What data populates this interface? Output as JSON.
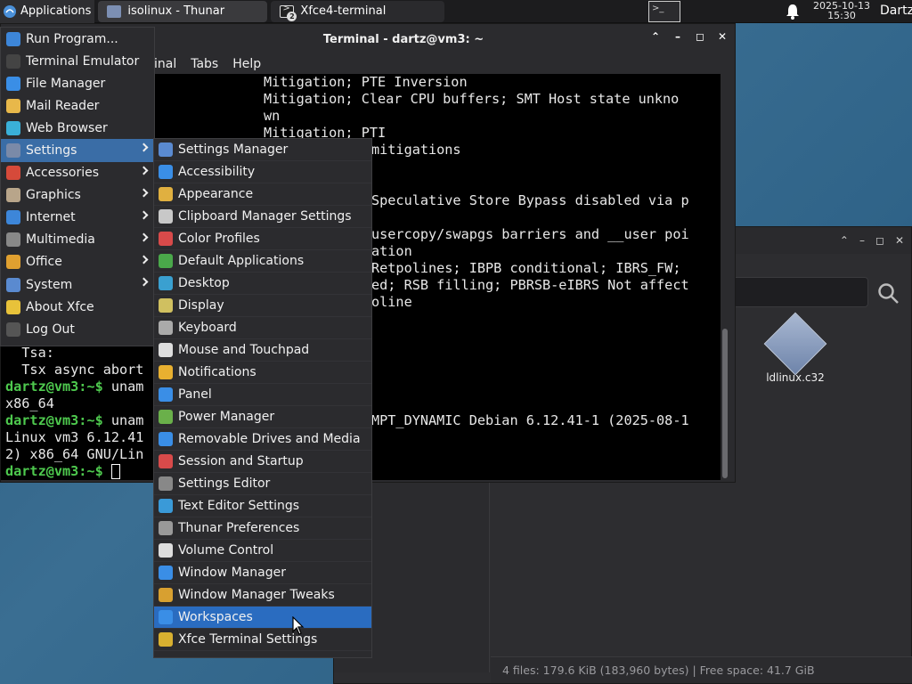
{
  "panel": {
    "applications_label": "Applications",
    "tasks": [
      {
        "label": "isolinux - Thunar",
        "icon": "folder-icon"
      },
      {
        "label": "Xfce4-terminal",
        "icon": "terminal-icon",
        "badge": "2"
      }
    ],
    "clock_date": "2025-10-13",
    "clock_time": "15:30",
    "user": "Dartz"
  },
  "terminal": {
    "title": "Terminal - dartz@vm3: ~",
    "menu": [
      "inal",
      "Tabs",
      "Help"
    ],
    "right_lines": [
      "Mitigation; PTE Inversion",
      "Mitigation; Clear CPU buffers; SMT Host state unkno",
      "wn",
      "Mitigation; PTI",
      "mitigations",
      "",
      "",
      "Speculative Store Bypass disabled via p",
      "",
      "usercopy/swapgs barriers and __user poi",
      "ation",
      "Retpolines; IBPB conditional; IBRS_FW;",
      "ed; RSB filling; PBRSB-eIBRS Not affect",
      "oline",
      "",
      "",
      "",
      "",
      "",
      "",
      "MPT_DYNAMIC Debian 6.12.41-1 (2025-08-1"
    ],
    "left_lines": [
      {
        "text": "  Tsa:",
        "prompt": ""
      },
      {
        "text": "  Tsx async abort",
        "prompt": ""
      },
      {
        "prompt": "dartz@vm3:~$ ",
        "text": "unam"
      },
      {
        "text": "x86_64",
        "prompt": ""
      },
      {
        "prompt": "dartz@vm3:~$ ",
        "text": "unam"
      },
      {
        "text": "Linux vm3 6.12.41",
        "prompt": ""
      },
      {
        "text": "2) x86_64 GNU/Lin",
        "prompt": ""
      },
      {
        "prompt": "dartz@vm3:~$ ",
        "text": ""
      }
    ]
  },
  "thunar": {
    "file_label": "ldlinux.c32",
    "status": "4 files: 179.6 KiB (183,960 bytes)  |  Free space: 41.7 GiB"
  },
  "app_menu": {
    "items": [
      {
        "label": "Run Program...",
        "icon": "run-icon",
        "color": "#3d86d9"
      },
      {
        "label": "Terminal Emulator",
        "icon": "terminal-icon",
        "color": "#444"
      },
      {
        "label": "File Manager",
        "icon": "file-manager-icon",
        "color": "#3a8ee6"
      },
      {
        "label": "Mail Reader",
        "icon": "mail-icon",
        "color": "#e8b84a"
      },
      {
        "label": "Web Browser",
        "icon": "globe-icon",
        "color": "#3ab0d8"
      },
      {
        "label": "Settings",
        "icon": "settings-icon",
        "color": "#7a8aa8",
        "submenu": true,
        "active": true
      },
      {
        "label": "Accessories",
        "icon": "accessories-icon",
        "color": "#d64a3a",
        "submenu": true
      },
      {
        "label": "Graphics",
        "icon": "graphics-icon",
        "color": "#b8a58a",
        "submenu": true
      },
      {
        "label": "Internet",
        "icon": "internet-icon",
        "color": "#3d86d9",
        "submenu": true
      },
      {
        "label": "Multimedia",
        "icon": "multimedia-icon",
        "color": "#888",
        "submenu": true
      },
      {
        "label": "Office",
        "icon": "office-icon",
        "color": "#e0a030",
        "submenu": true
      },
      {
        "label": "System",
        "icon": "system-icon",
        "color": "#5a8ad0",
        "submenu": true
      },
      {
        "label": "About Xfce",
        "icon": "star-icon",
        "color": "#e8c23a"
      },
      {
        "label": "Log Out",
        "icon": "logout-icon",
        "color": "#555"
      }
    ]
  },
  "settings_menu": {
    "items": [
      {
        "label": "Settings Manager",
        "icon": "settings-manager-icon",
        "color": "#5a8ad0"
      },
      {
        "label": "Accessibility",
        "icon": "accessibility-icon",
        "color": "#3a8ee6"
      },
      {
        "label": "Appearance",
        "icon": "appearance-icon",
        "color": "#e0b040"
      },
      {
        "label": "Clipboard Manager Settings",
        "icon": "clipboard-icon",
        "color": "#c8c8c8"
      },
      {
        "label": "Color Profiles",
        "icon": "color-profiles-icon",
        "color": "#d84a4a"
      },
      {
        "label": "Default Applications",
        "icon": "default-apps-icon",
        "color": "#4aa84a"
      },
      {
        "label": "Desktop",
        "icon": "desktop-icon",
        "color": "#3aa0d0"
      },
      {
        "label": "Display",
        "icon": "display-icon",
        "color": "#d0c060"
      },
      {
        "label": "Keyboard",
        "icon": "keyboard-icon",
        "color": "#aaaaaa"
      },
      {
        "label": "Mouse and Touchpad",
        "icon": "mouse-icon",
        "color": "#dddddd"
      },
      {
        "label": "Notifications",
        "icon": "bell-icon",
        "color": "#e8b030"
      },
      {
        "label": "Panel",
        "icon": "panel-icon",
        "color": "#3a8ee6"
      },
      {
        "label": "Power Manager",
        "icon": "power-icon",
        "color": "#6ab04a"
      },
      {
        "label": "Removable Drives and Media",
        "icon": "removable-drive-icon",
        "color": "#3a8ee6"
      },
      {
        "label": "Session and Startup",
        "icon": "session-icon",
        "color": "#d84a4a"
      },
      {
        "label": "Settings Editor",
        "icon": "settings-editor-icon",
        "color": "#888888"
      },
      {
        "label": "Text Editor Settings",
        "icon": "text-editor-icon",
        "color": "#3a9ad8"
      },
      {
        "label": "Thunar Preferences",
        "icon": "thunar-prefs-icon",
        "color": "#999999"
      },
      {
        "label": "Volume Control",
        "icon": "volume-icon",
        "color": "#dddddd"
      },
      {
        "label": "Window Manager",
        "icon": "window-manager-icon",
        "color": "#3a8ee6"
      },
      {
        "label": "Window Manager Tweaks",
        "icon": "wm-tweaks-icon",
        "color": "#d8a030"
      },
      {
        "label": "Workspaces",
        "icon": "workspaces-icon",
        "color": "#3a8ee6",
        "active": true
      },
      {
        "label": "Xfce Terminal Settings",
        "icon": "terminal-settings-icon",
        "color": "#d8b030"
      }
    ]
  }
}
